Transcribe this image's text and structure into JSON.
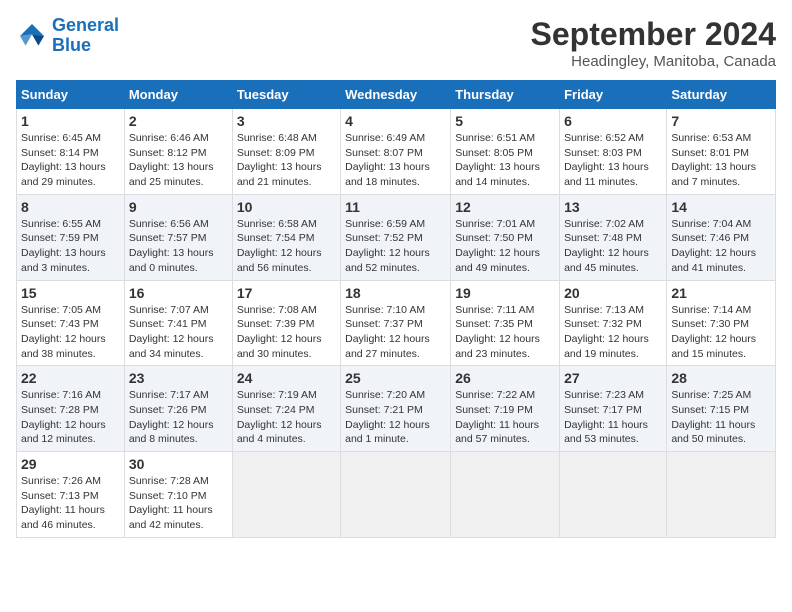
{
  "header": {
    "logo_line1": "General",
    "logo_line2": "Blue",
    "month": "September 2024",
    "location": "Headingley, Manitoba, Canada"
  },
  "days_of_week": [
    "Sunday",
    "Monday",
    "Tuesday",
    "Wednesday",
    "Thursday",
    "Friday",
    "Saturday"
  ],
  "weeks": [
    [
      {
        "day": "1",
        "sunrise": "Sunrise: 6:45 AM",
        "sunset": "Sunset: 8:14 PM",
        "daylight": "Daylight: 13 hours and 29 minutes."
      },
      {
        "day": "2",
        "sunrise": "Sunrise: 6:46 AM",
        "sunset": "Sunset: 8:12 PM",
        "daylight": "Daylight: 13 hours and 25 minutes."
      },
      {
        "day": "3",
        "sunrise": "Sunrise: 6:48 AM",
        "sunset": "Sunset: 8:09 PM",
        "daylight": "Daylight: 13 hours and 21 minutes."
      },
      {
        "day": "4",
        "sunrise": "Sunrise: 6:49 AM",
        "sunset": "Sunset: 8:07 PM",
        "daylight": "Daylight: 13 hours and 18 minutes."
      },
      {
        "day": "5",
        "sunrise": "Sunrise: 6:51 AM",
        "sunset": "Sunset: 8:05 PM",
        "daylight": "Daylight: 13 hours and 14 minutes."
      },
      {
        "day": "6",
        "sunrise": "Sunrise: 6:52 AM",
        "sunset": "Sunset: 8:03 PM",
        "daylight": "Daylight: 13 hours and 11 minutes."
      },
      {
        "day": "7",
        "sunrise": "Sunrise: 6:53 AM",
        "sunset": "Sunset: 8:01 PM",
        "daylight": "Daylight: 13 hours and 7 minutes."
      }
    ],
    [
      {
        "day": "8",
        "sunrise": "Sunrise: 6:55 AM",
        "sunset": "Sunset: 7:59 PM",
        "daylight": "Daylight: 13 hours and 3 minutes."
      },
      {
        "day": "9",
        "sunrise": "Sunrise: 6:56 AM",
        "sunset": "Sunset: 7:57 PM",
        "daylight": "Daylight: 13 hours and 0 minutes."
      },
      {
        "day": "10",
        "sunrise": "Sunrise: 6:58 AM",
        "sunset": "Sunset: 7:54 PM",
        "daylight": "Daylight: 12 hours and 56 minutes."
      },
      {
        "day": "11",
        "sunrise": "Sunrise: 6:59 AM",
        "sunset": "Sunset: 7:52 PM",
        "daylight": "Daylight: 12 hours and 52 minutes."
      },
      {
        "day": "12",
        "sunrise": "Sunrise: 7:01 AM",
        "sunset": "Sunset: 7:50 PM",
        "daylight": "Daylight: 12 hours and 49 minutes."
      },
      {
        "day": "13",
        "sunrise": "Sunrise: 7:02 AM",
        "sunset": "Sunset: 7:48 PM",
        "daylight": "Daylight: 12 hours and 45 minutes."
      },
      {
        "day": "14",
        "sunrise": "Sunrise: 7:04 AM",
        "sunset": "Sunset: 7:46 PM",
        "daylight": "Daylight: 12 hours and 41 minutes."
      }
    ],
    [
      {
        "day": "15",
        "sunrise": "Sunrise: 7:05 AM",
        "sunset": "Sunset: 7:43 PM",
        "daylight": "Daylight: 12 hours and 38 minutes."
      },
      {
        "day": "16",
        "sunrise": "Sunrise: 7:07 AM",
        "sunset": "Sunset: 7:41 PM",
        "daylight": "Daylight: 12 hours and 34 minutes."
      },
      {
        "day": "17",
        "sunrise": "Sunrise: 7:08 AM",
        "sunset": "Sunset: 7:39 PM",
        "daylight": "Daylight: 12 hours and 30 minutes."
      },
      {
        "day": "18",
        "sunrise": "Sunrise: 7:10 AM",
        "sunset": "Sunset: 7:37 PM",
        "daylight": "Daylight: 12 hours and 27 minutes."
      },
      {
        "day": "19",
        "sunrise": "Sunrise: 7:11 AM",
        "sunset": "Sunset: 7:35 PM",
        "daylight": "Daylight: 12 hours and 23 minutes."
      },
      {
        "day": "20",
        "sunrise": "Sunrise: 7:13 AM",
        "sunset": "Sunset: 7:32 PM",
        "daylight": "Daylight: 12 hours and 19 minutes."
      },
      {
        "day": "21",
        "sunrise": "Sunrise: 7:14 AM",
        "sunset": "Sunset: 7:30 PM",
        "daylight": "Daylight: 12 hours and 15 minutes."
      }
    ],
    [
      {
        "day": "22",
        "sunrise": "Sunrise: 7:16 AM",
        "sunset": "Sunset: 7:28 PM",
        "daylight": "Daylight: 12 hours and 12 minutes."
      },
      {
        "day": "23",
        "sunrise": "Sunrise: 7:17 AM",
        "sunset": "Sunset: 7:26 PM",
        "daylight": "Daylight: 12 hours and 8 minutes."
      },
      {
        "day": "24",
        "sunrise": "Sunrise: 7:19 AM",
        "sunset": "Sunset: 7:24 PM",
        "daylight": "Daylight: 12 hours and 4 minutes."
      },
      {
        "day": "25",
        "sunrise": "Sunrise: 7:20 AM",
        "sunset": "Sunset: 7:21 PM",
        "daylight": "Daylight: 12 hours and 1 minute."
      },
      {
        "day": "26",
        "sunrise": "Sunrise: 7:22 AM",
        "sunset": "Sunset: 7:19 PM",
        "daylight": "Daylight: 11 hours and 57 minutes."
      },
      {
        "day": "27",
        "sunrise": "Sunrise: 7:23 AM",
        "sunset": "Sunset: 7:17 PM",
        "daylight": "Daylight: 11 hours and 53 minutes."
      },
      {
        "day": "28",
        "sunrise": "Sunrise: 7:25 AM",
        "sunset": "Sunset: 7:15 PM",
        "daylight": "Daylight: 11 hours and 50 minutes."
      }
    ],
    [
      {
        "day": "29",
        "sunrise": "Sunrise: 7:26 AM",
        "sunset": "Sunset: 7:13 PM",
        "daylight": "Daylight: 11 hours and 46 minutes."
      },
      {
        "day": "30",
        "sunrise": "Sunrise: 7:28 AM",
        "sunset": "Sunset: 7:10 PM",
        "daylight": "Daylight: 11 hours and 42 minutes."
      },
      null,
      null,
      null,
      null,
      null
    ]
  ]
}
